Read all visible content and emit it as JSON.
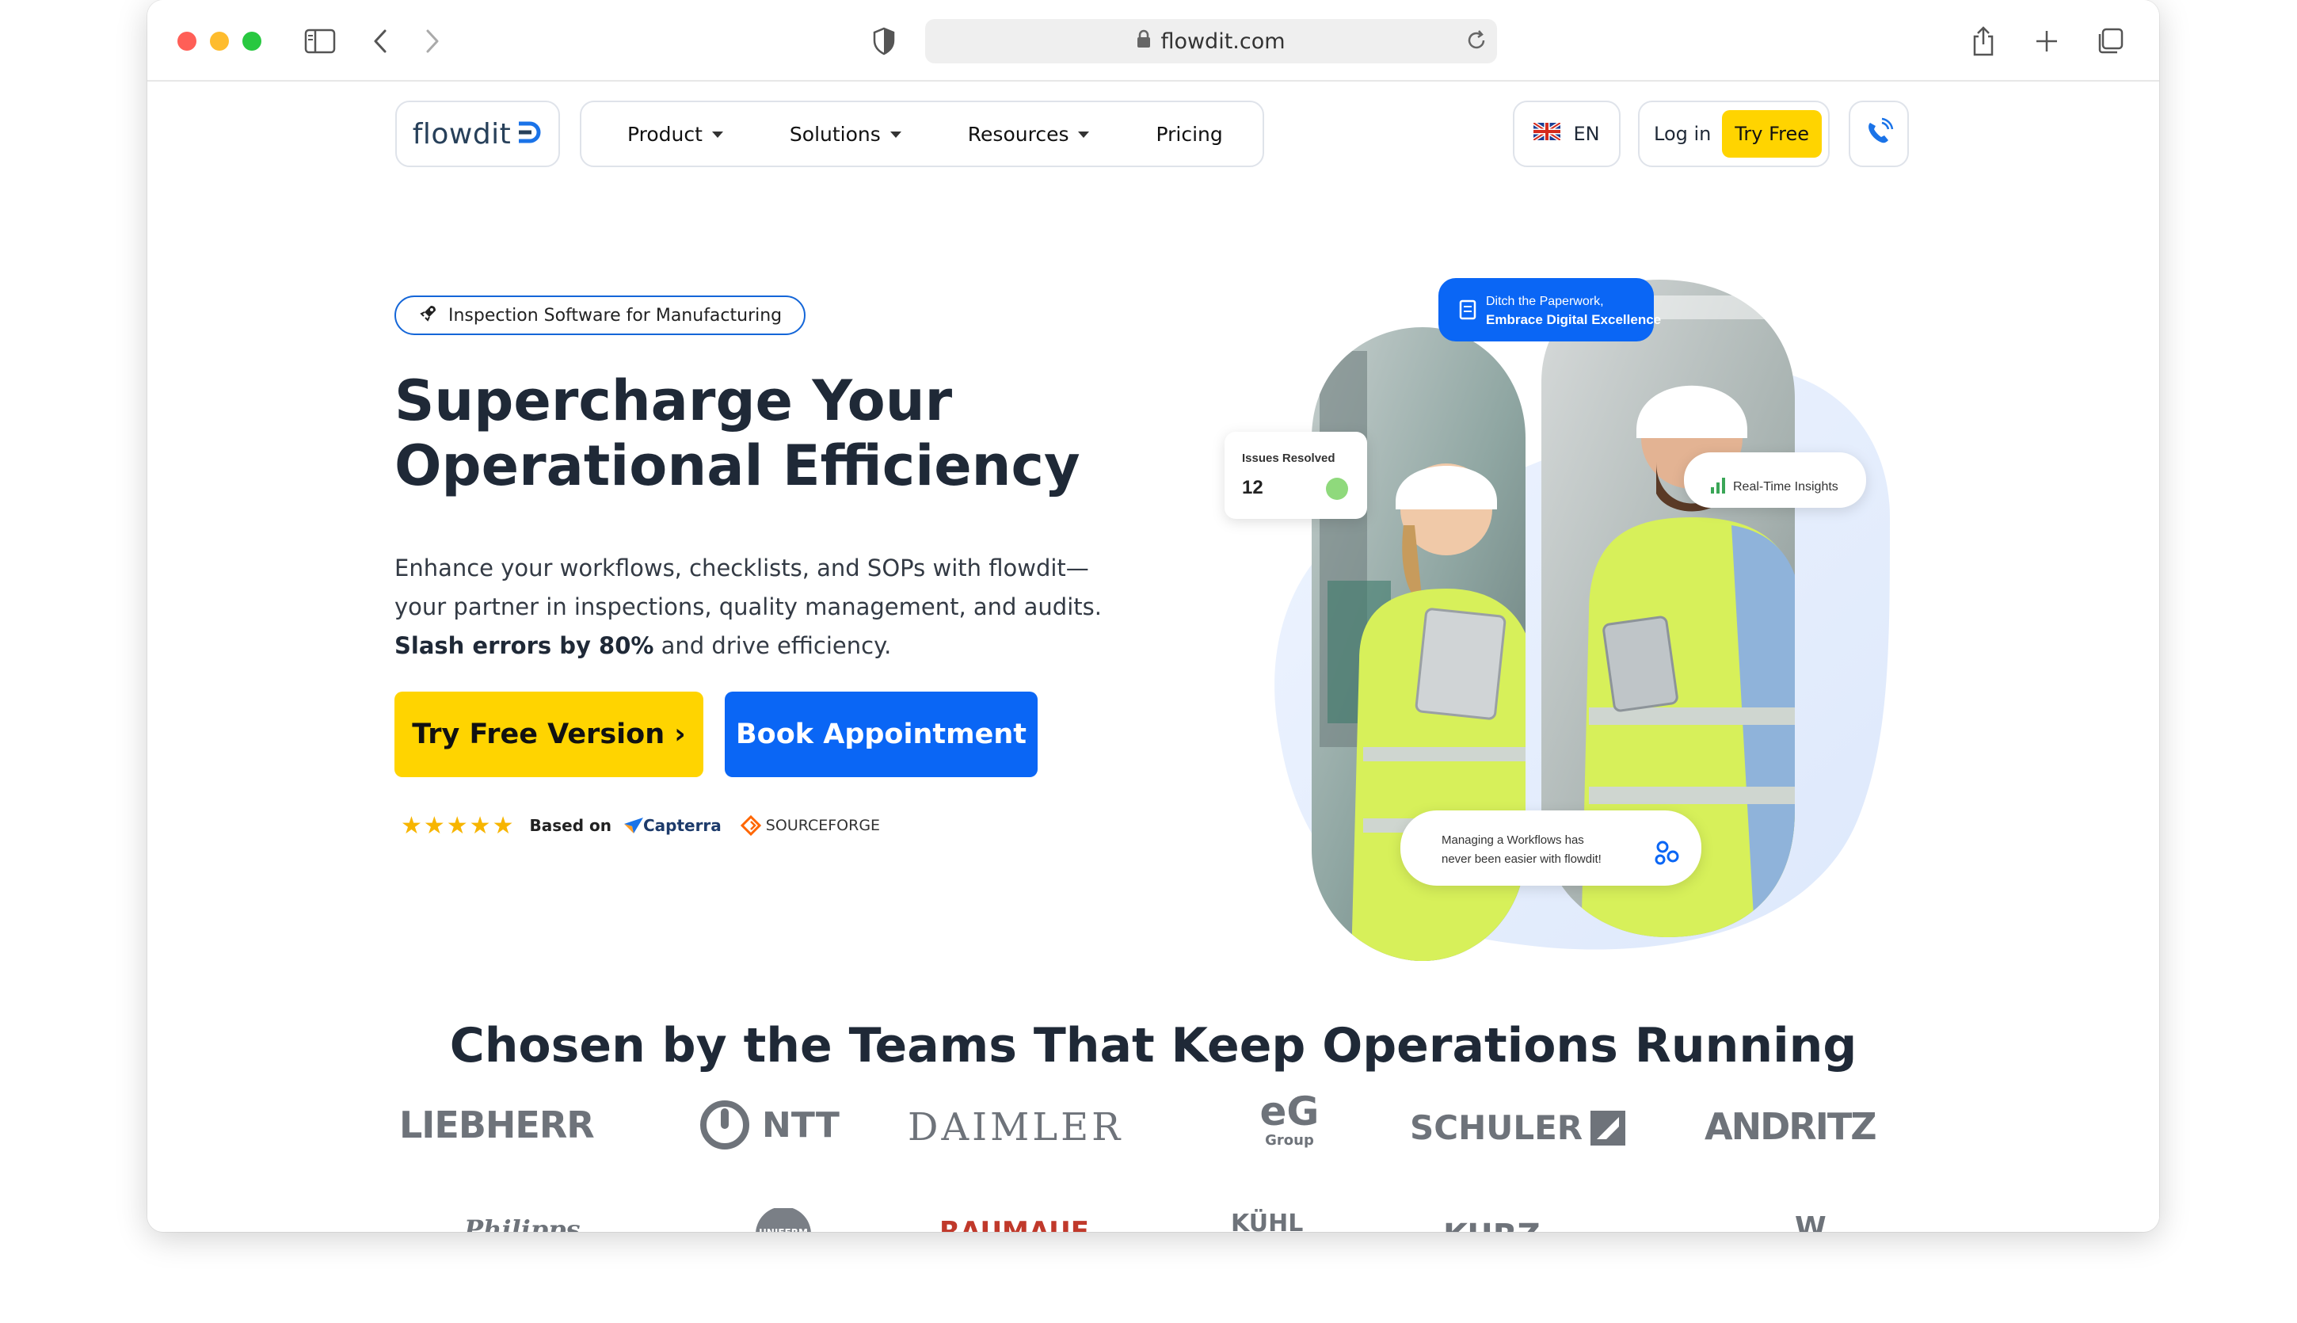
{
  "browser": {
    "url": "flowdit.com"
  },
  "nav": {
    "logo": "flowdit",
    "menu": [
      {
        "label": "Product",
        "has_caret": true
      },
      {
        "label": "Solutions",
        "has_caret": true
      },
      {
        "label": "Resources",
        "has_caret": true
      },
      {
        "label": "Pricing",
        "has_caret": false
      }
    ],
    "language": "EN",
    "login": "Log in",
    "try_free": "Try Free"
  },
  "hero": {
    "badge": "Inspection Software for Manufacturing",
    "headline_line1": "Supercharge Your",
    "headline_line2": "Operational Efficiency",
    "sub_part1": "Enhance your workflows, checklists, and SOPs with flowdit—your partner in inspections, quality management, and audits. ",
    "sub_bold": "Slash errors by 80%",
    "sub_part2": " and drive efficiency.",
    "cta_primary": "Try Free Version ›",
    "cta_secondary": "Book Appointment",
    "stars": "★★★★★",
    "rating_based": "Based on",
    "rating_source1": "Capterra",
    "rating_source2": "SOURCEFORGE"
  },
  "art": {
    "bubble_top_line1": "Ditch the Paperwork,",
    "bubble_top_line2": "Embrace Digital Excellence",
    "issues_label": "Issues Resolved",
    "issues_value": "12",
    "insights_label": "Real-Time Insights",
    "bottom_line1": "Managing a Workflows  has",
    "bottom_line2": "never been easier with flowdit!"
  },
  "clients": {
    "title": "Chosen by the Teams That Keep Operations Running",
    "row1": [
      "LIEBHERR",
      "NTT",
      "DAIMLER",
      "eG",
      "Group",
      "SCHULER",
      "ANDRITZ"
    ],
    "row2": [
      "Philipps",
      "UNIFERM",
      "RAUMAUF",
      "KÜHL",
      "KURZ",
      "W"
    ]
  },
  "colors": {
    "yellow": "#ffd400",
    "blue": "#0a66f5",
    "text_dark": "#1f2937"
  }
}
